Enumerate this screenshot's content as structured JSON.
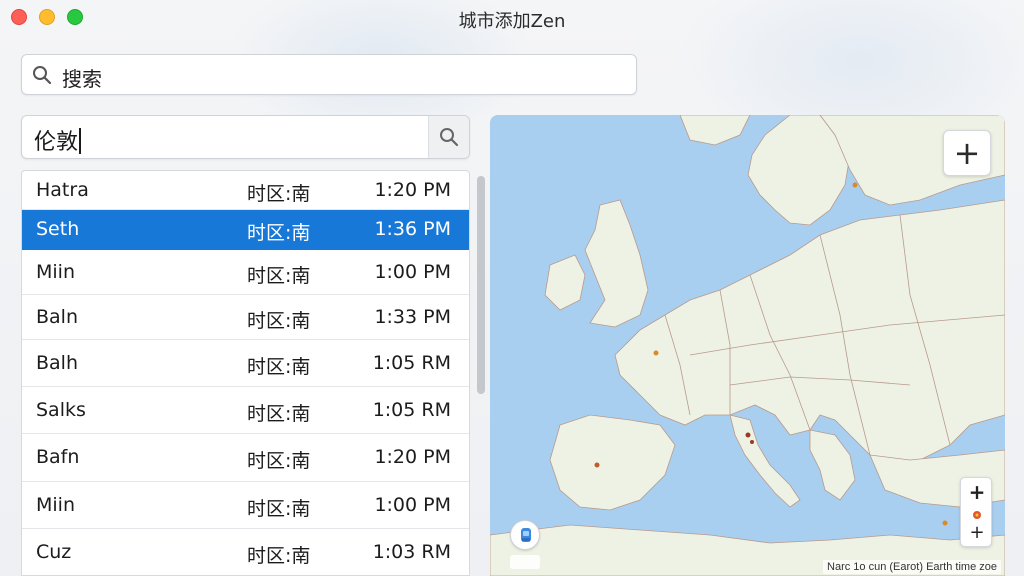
{
  "window": {
    "title": "城市添加Zen"
  },
  "search": {
    "placeholder": "搜索"
  },
  "city_input": {
    "value": "伦敦"
  },
  "cities": [
    {
      "name": "Hatra",
      "timezone": "时区:南",
      "time": "1:20 PM",
      "selected": false
    },
    {
      "name": "Seth",
      "timezone": "时区:南",
      "time": "1:36 PM",
      "selected": true
    },
    {
      "name": "Miin",
      "timezone": "时区:南",
      "time": "1:00 PM",
      "selected": false
    },
    {
      "name": "Baln",
      "timezone": "时区:南",
      "time": "1:33 PM",
      "selected": false
    },
    {
      "name": "Balh",
      "timezone": "时区:南",
      "time": "1:05 RM",
      "selected": false
    },
    {
      "name": "Salks",
      "timezone": "时区:南",
      "time": "1:05 RM",
      "selected": false
    },
    {
      "name": "Bafn",
      "timezone": "时区:南",
      "time": "1:20 PM",
      "selected": false
    },
    {
      "name": "Miin",
      "timezone": "时区:南",
      "time": "1:00 PM",
      "selected": false
    },
    {
      "name": "Cuz",
      "timezone": "时区:南",
      "time": "1:03 RM",
      "selected": false
    }
  ],
  "map": {
    "add_label": "+",
    "zoom_in_label": "+",
    "zoom_out_label": "+",
    "attribution": "Narc 1o cun (Earot) Earth time zoe",
    "colors": {
      "water": "#a9cff0",
      "land": "#eef2e4",
      "border": "#b89a8c"
    }
  },
  "colors": {
    "selection": "#1778d8"
  }
}
